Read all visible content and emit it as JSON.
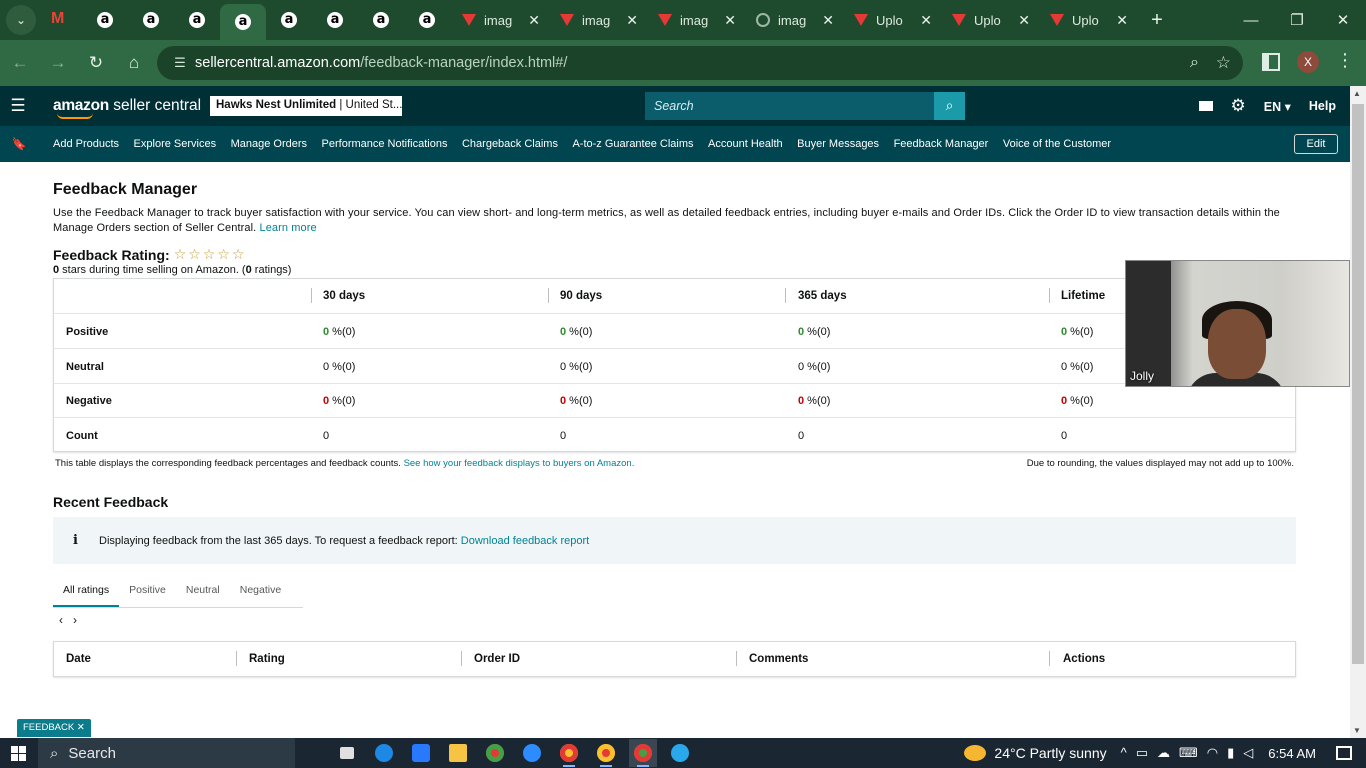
{
  "browser": {
    "tabs": [
      {
        "title": "imag",
        "icon": "red-v-icon"
      },
      {
        "title": "imag",
        "icon": "red-v-icon"
      },
      {
        "title": "imag",
        "icon": "red-v-icon"
      },
      {
        "title": "imag",
        "icon": "globe-icon"
      },
      {
        "title": "Uplo",
        "icon": "red-v-icon"
      },
      {
        "title": "Uplo",
        "icon": "red-v-icon"
      },
      {
        "title": "Uplo",
        "icon": "red-v-icon"
      }
    ],
    "pinned_tab_letter": "a",
    "url_domain": "sellercentral.amazon.com",
    "url_path": "/feedback-manager/index.html#/",
    "profile_initial": "X"
  },
  "header": {
    "logo_amazon": "amazon",
    "logo_rest": " seller central",
    "account_bold": "Hawks Nest Unlimited",
    "account_rest": " | United St...",
    "search_placeholder": "Search",
    "language": "EN",
    "help": "Help"
  },
  "nav": {
    "links": [
      "Add Products",
      "Explore Services",
      "Manage Orders",
      "Performance Notifications",
      "Chargeback Claims",
      "A-to-z Guarantee Claims",
      "Account Health",
      "Buyer Messages",
      "Feedback Manager",
      "Voice of the Customer"
    ],
    "edit": "Edit"
  },
  "page": {
    "title": "Feedback Manager",
    "intro": "Use the Feedback Manager to track buyer satisfaction with your service. You can view short- and long-term metrics, as well as detailed feedback entries, including buyer e-mails and Order IDs. Click the Order ID to view transaction details within the Manage Orders section of Seller Central.",
    "learn_more": "Learn more",
    "rating_label": "Feedback Rating:",
    "stars": "☆☆☆☆☆",
    "rating_sub_count": "0",
    "rating_sub_text": " stars during time selling on Amazon. (",
    "rating_sub_ratings": "0",
    "rating_sub_end": " ratings)"
  },
  "feedback_table": {
    "columns": [
      "30 days",
      "90 days",
      "365 days",
      "Lifetime"
    ],
    "rows": [
      {
        "label": "Positive",
        "values": [
          "0",
          "0",
          "0",
          "0"
        ],
        "suffix": " %(0)",
        "tone": "green"
      },
      {
        "label": "Neutral",
        "values": [
          "0",
          "0",
          "0",
          "0"
        ],
        "suffix": " %(0)",
        "tone": "muted"
      },
      {
        "label": "Negative",
        "values": [
          "0",
          "0",
          "0",
          "0"
        ],
        "suffix": " %(0)",
        "tone": "red"
      },
      {
        "label": "Count",
        "values": [
          "0",
          "0",
          "0",
          "0"
        ],
        "suffix": "",
        "tone": "plain"
      }
    ],
    "note_text": "This table displays the corresponding feedback percentages and feedback counts.",
    "note_link": "See how your feedback displays to buyers on Amazon.",
    "rounding_note": "Due to rounding, the values displayed may not add up to 100%."
  },
  "recent": {
    "title": "Recent Feedback",
    "info_text": "Displaying feedback from the last 365 days. To request a feedback report:",
    "info_link": "Download feedback report",
    "tabs": [
      "All ratings",
      "Positive",
      "Neutral",
      "Negative"
    ],
    "active_tab": "All ratings",
    "pager_prev": "‹",
    "pager_next": "›",
    "columns": [
      "Date",
      "Rating",
      "Order ID",
      "Comments",
      "Actions"
    ]
  },
  "feedback_tag": "FEEDBACK ✕",
  "video_overlay": {
    "name": "Jolly"
  },
  "taskbar": {
    "search": "Search",
    "weather": "24°C  Partly sunny",
    "time": "6:54 AM"
  },
  "colors": {
    "header_bg": "#002f36",
    "nav_bg": "#00454f",
    "link": "#008296",
    "positive": "#2e8b2e",
    "negative": "#c40000"
  }
}
